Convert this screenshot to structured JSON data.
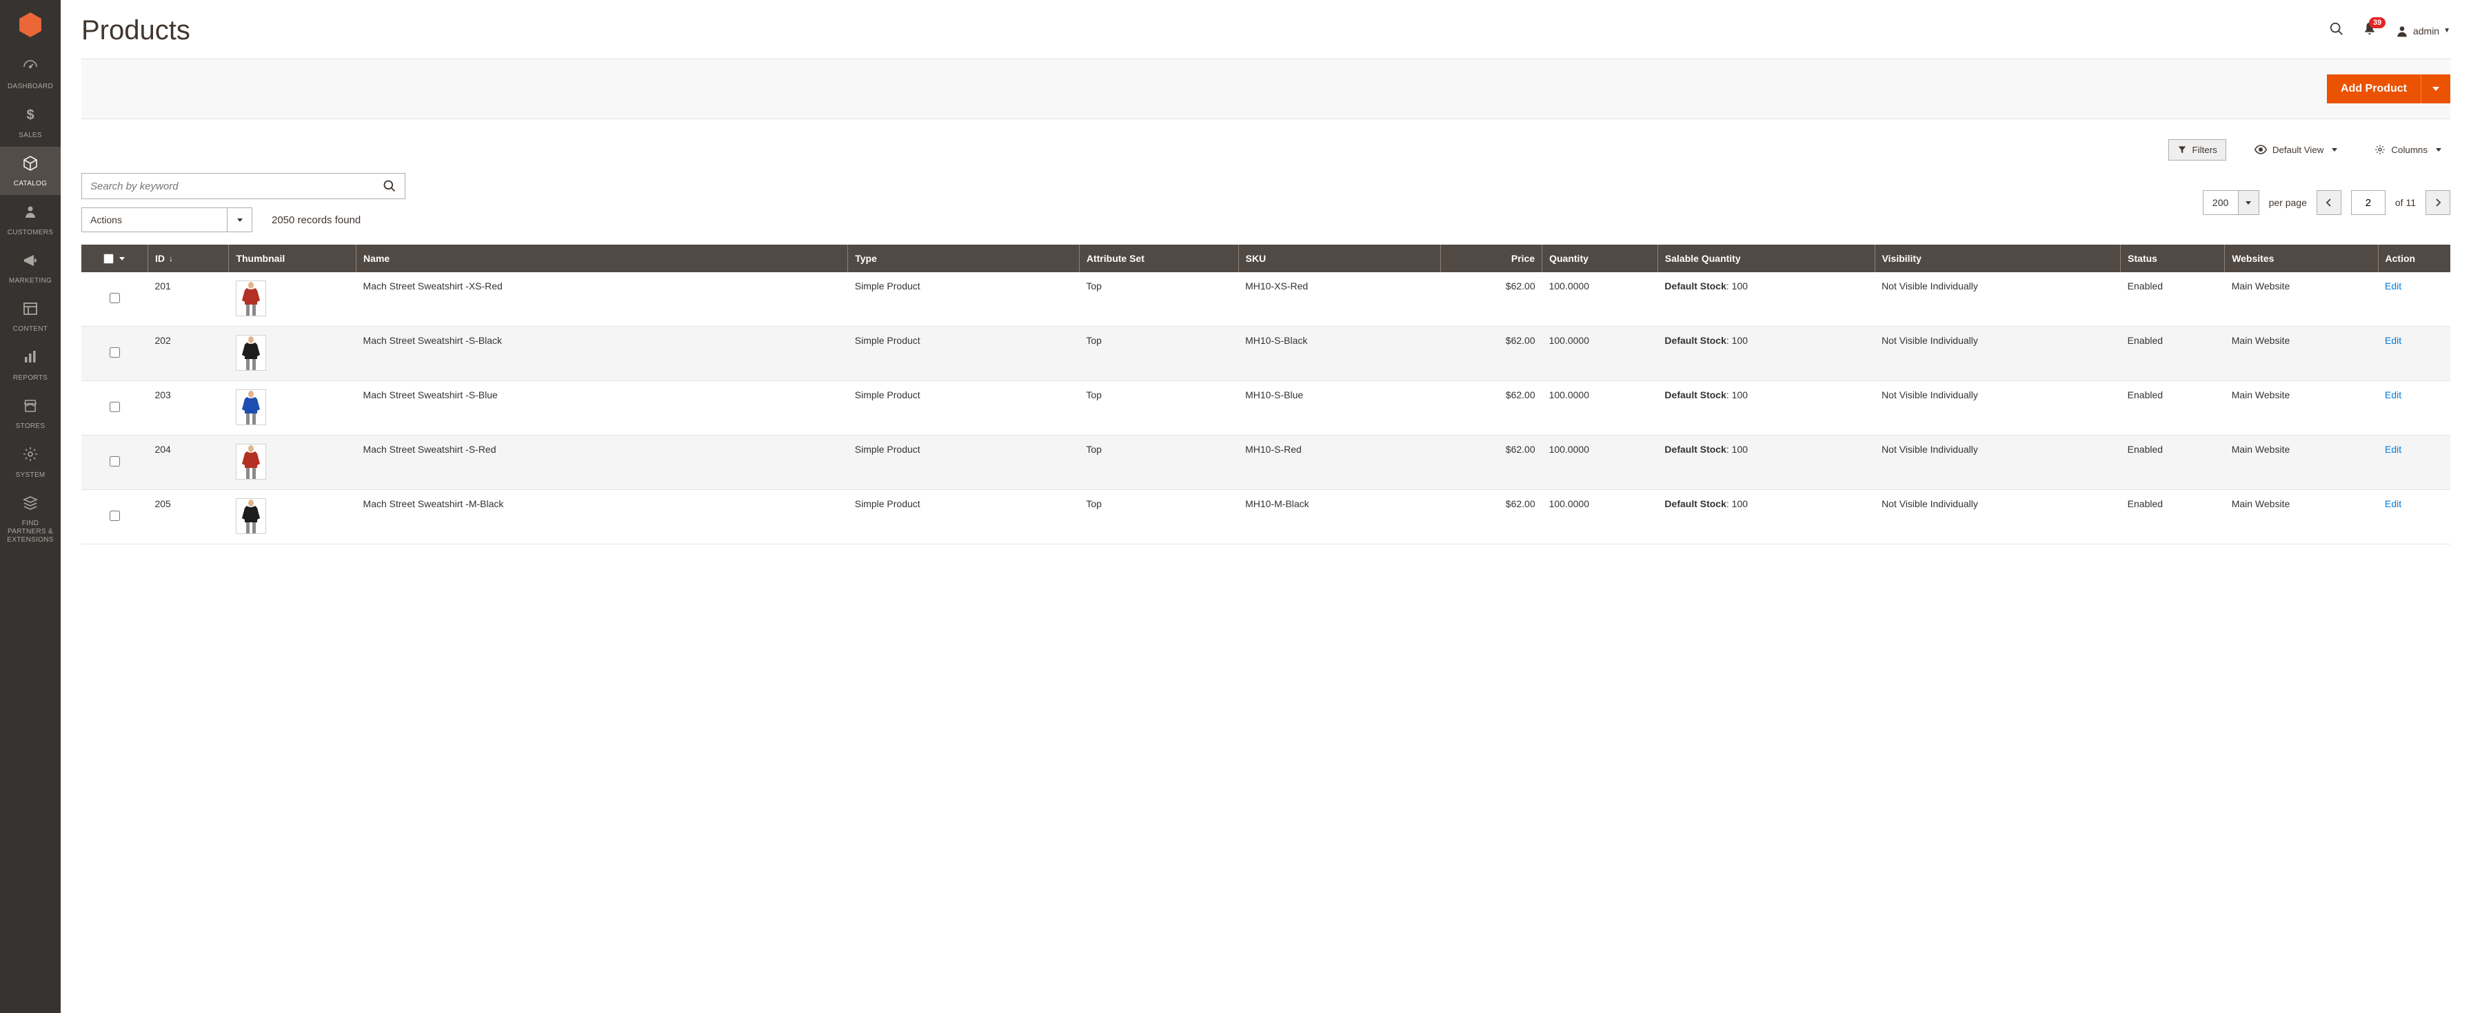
{
  "sidebar": {
    "items": [
      {
        "label": "DASHBOARD",
        "icon": "dashboard"
      },
      {
        "label": "SALES",
        "icon": "dollar"
      },
      {
        "label": "CATALOG",
        "icon": "cube",
        "active": true
      },
      {
        "label": "CUSTOMERS",
        "icon": "person"
      },
      {
        "label": "MARKETING",
        "icon": "megaphone"
      },
      {
        "label": "CONTENT",
        "icon": "layout"
      },
      {
        "label": "REPORTS",
        "icon": "barchart"
      },
      {
        "label": "STORES",
        "icon": "store"
      },
      {
        "label": "SYSTEM",
        "icon": "gear"
      },
      {
        "label": "FIND PARTNERS & EXTENSIONS",
        "icon": "stack"
      }
    ]
  },
  "header": {
    "title": "Products",
    "notif_count": "39",
    "user": "admin"
  },
  "add_button": {
    "label": "Add Product"
  },
  "toolbar": {
    "filters": "Filters",
    "view_label": "Default View",
    "columns": "Columns"
  },
  "search": {
    "placeholder": "Search by keyword"
  },
  "actions": {
    "label": "Actions"
  },
  "records_found": "2050 records found",
  "pager": {
    "per_page_value": "200",
    "per_page_label": "per page",
    "page_value": "2",
    "of_label": "of 11"
  },
  "columns": {
    "id": "ID",
    "thumb": "Thumbnail",
    "name": "Name",
    "type": "Type",
    "attr": "Attribute Set",
    "sku": "SKU",
    "price": "Price",
    "qty": "Quantity",
    "salable": "Salable Quantity",
    "visibility": "Visibility",
    "status": "Status",
    "websites": "Websites",
    "action": "Action"
  },
  "salable_prefix": "Default Stock",
  "edit_label": "Edit",
  "rows": [
    {
      "id": "201",
      "name": "Mach Street Sweatshirt -XS-Red",
      "type": "Simple Product",
      "attr": "Top",
      "sku": "MH10-XS-Red",
      "price": "$62.00",
      "qty": "100.0000",
      "salable": "100",
      "visibility": "Not Visible Individually",
      "status": "Enabled",
      "websites": "Main Website",
      "color": "#b33124"
    },
    {
      "id": "202",
      "name": "Mach Street Sweatshirt -S-Black",
      "type": "Simple Product",
      "attr": "Top",
      "sku": "MH10-S-Black",
      "price": "$62.00",
      "qty": "100.0000",
      "salable": "100",
      "visibility": "Not Visible Individually",
      "status": "Enabled",
      "websites": "Main Website",
      "color": "#1d1d1d"
    },
    {
      "id": "203",
      "name": "Mach Street Sweatshirt -S-Blue",
      "type": "Simple Product",
      "attr": "Top",
      "sku": "MH10-S-Blue",
      "price": "$62.00",
      "qty": "100.0000",
      "salable": "100",
      "visibility": "Not Visible Individually",
      "status": "Enabled",
      "websites": "Main Website",
      "color": "#1d4fb3"
    },
    {
      "id": "204",
      "name": "Mach Street Sweatshirt -S-Red",
      "type": "Simple Product",
      "attr": "Top",
      "sku": "MH10-S-Red",
      "price": "$62.00",
      "qty": "100.0000",
      "salable": "100",
      "visibility": "Not Visible Individually",
      "status": "Enabled",
      "websites": "Main Website",
      "color": "#b33124"
    },
    {
      "id": "205",
      "name": "Mach Street Sweatshirt -M-Black",
      "type": "Simple Product",
      "attr": "Top",
      "sku": "MH10-M-Black",
      "price": "$62.00",
      "qty": "100.0000",
      "salable": "100",
      "visibility": "Not Visible Individually",
      "status": "Enabled",
      "websites": "Main Website",
      "color": "#1d1d1d"
    }
  ]
}
